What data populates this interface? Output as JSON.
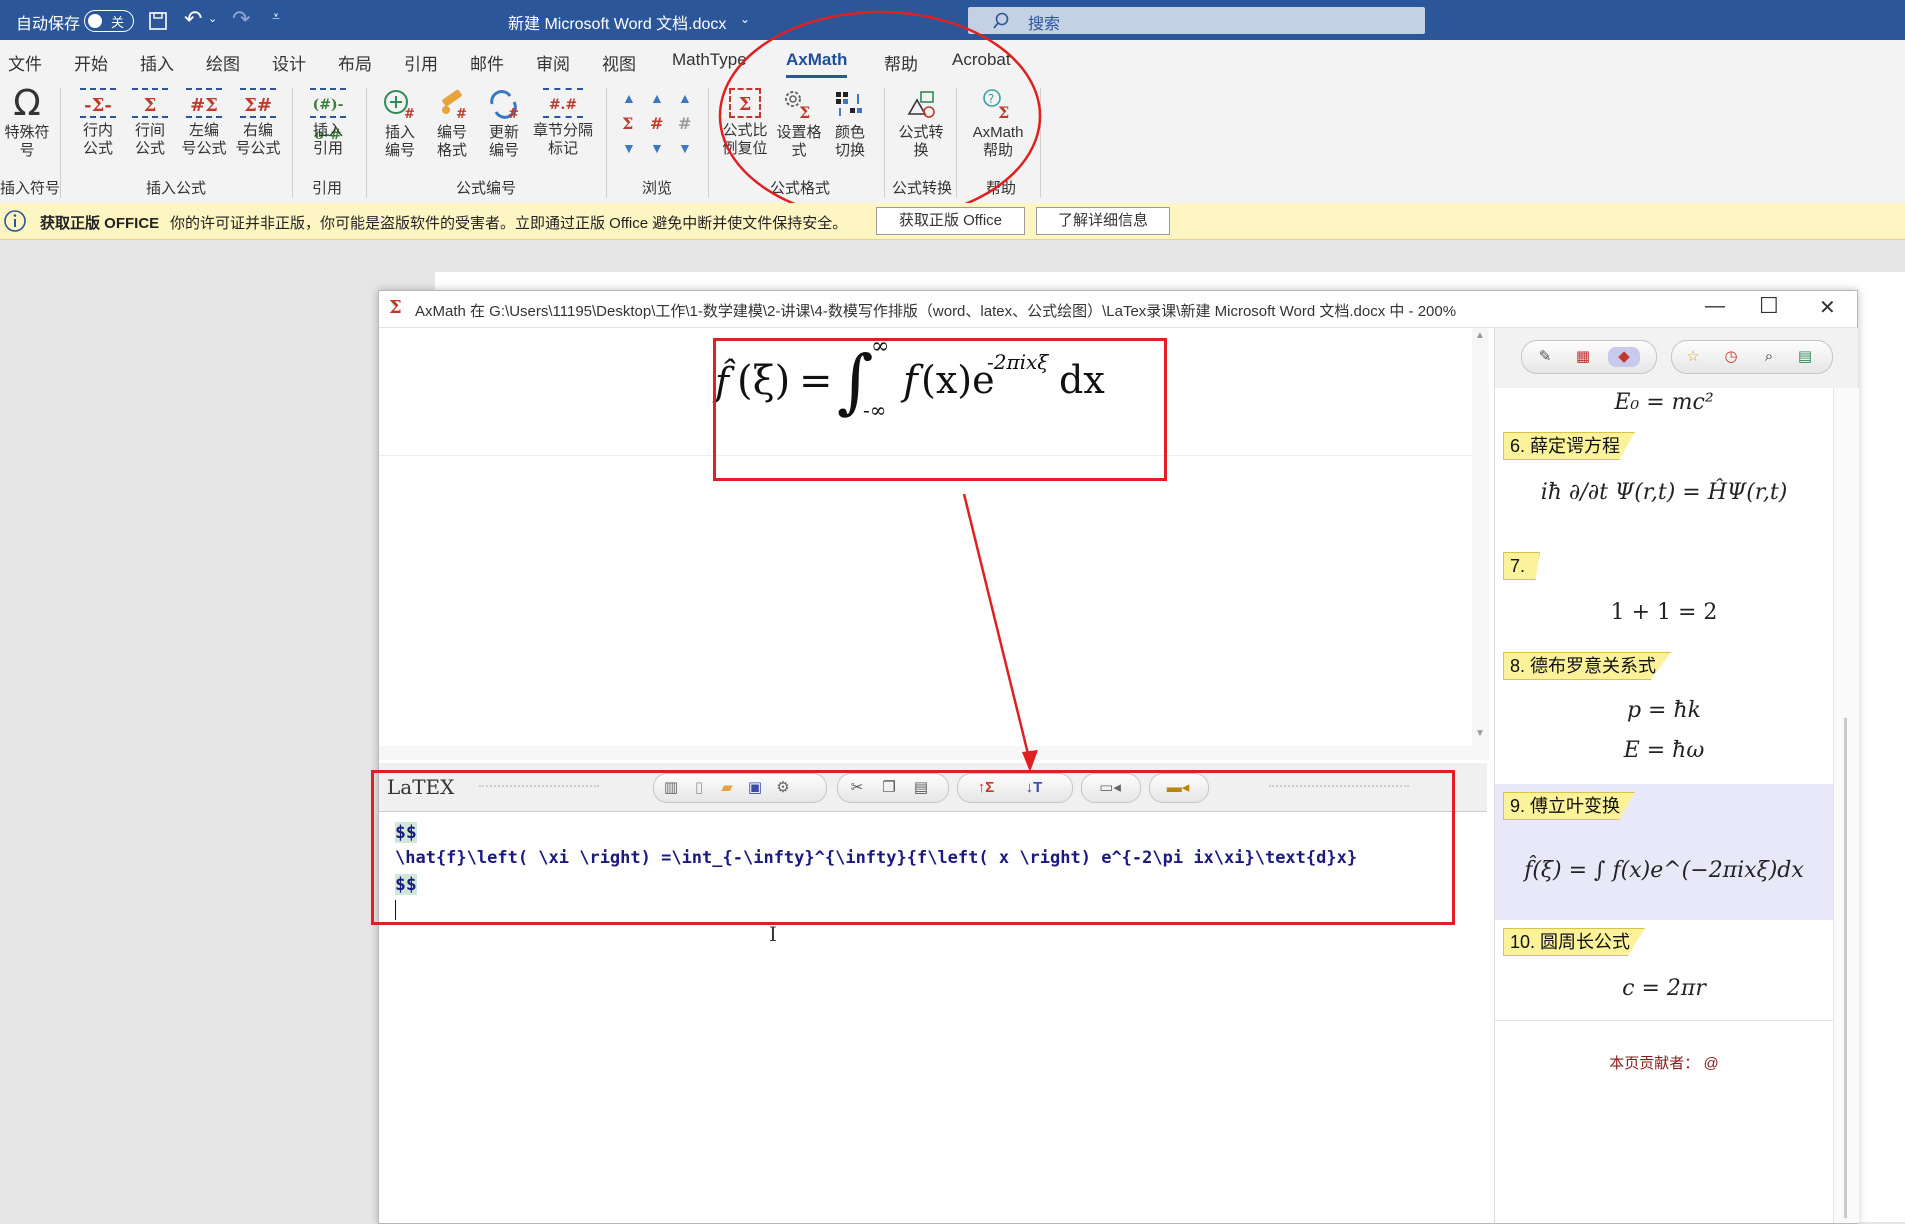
{
  "titlebar": {
    "autosave_label": "自动保存",
    "autosave_state": "关",
    "doc_title": "新建 Microsoft Word 文档.docx",
    "search_placeholder": "搜索"
  },
  "tabs": [
    "文件",
    "开始",
    "插入",
    "绘图",
    "设计",
    "布局",
    "引用",
    "邮件",
    "审阅",
    "视图",
    "MathType",
    "AxMath",
    "帮助",
    "Acrobat"
  ],
  "active_tab": "AxMath",
  "ribbon": {
    "special_symbol": "特殊符\n号",
    "inline_formula": "行内\n公式",
    "display_formula": "行间\n公式",
    "left_numbered": "左编\n号公式",
    "right_numbered": "右编\n号公式",
    "insert_ref": "插入\n引用",
    "insert_number": "插入\n编号",
    "number_format": "编号\n格式",
    "update_number": "更新\n编号",
    "chapter_mark": "章节分隔\n标记",
    "ratio_reset": "公式比\n例复位",
    "set_format": "设置格\n式",
    "color_switch": "颜色\n切换",
    "formula_convert": "公式转\n换",
    "axmath_help": "AxMath\n帮助",
    "groups": {
      "insert_symbol": "插入符号",
      "insert_formula": "插入公式",
      "reference": "引用",
      "formula_number": "公式编号",
      "browse": "浏览",
      "formula_format": "公式格式",
      "formula_convert": "公式转换",
      "help": "帮助"
    }
  },
  "notice": {
    "title": "获取正版 OFFICE",
    "message": "你的许可证并非正版，你可能是盗版软件的受害者。立即通过正版 Office 避免中断并使文件保持安全。",
    "btn_get": "获取正版 Office",
    "btn_more": "了解详细信息"
  },
  "axmath": {
    "title": "AxMath 在 G:\\Users\\11195\\Desktop\\工作\\1-数学建模\\2-讲课\\4-数模写作排版（word、latex、公式绘图）\\LaTex录课\\新建 Microsoft Word 文档.docx 中 - 200%",
    "latex_logo": "LaTEX",
    "code": {
      "line1": "$$",
      "line2": "\\hat{f}\\left( \\xi \\right) =\\int_{-\\infty}^{\\infty}{f\\left( x \\right) e^{-2\\pi ix\\xi}\\text{d}x}",
      "line3": "$$"
    }
  },
  "formula_library": {
    "top_formula": "E₀ = mc²",
    "items": [
      {
        "label": "6. 薛定谔方程",
        "formula": "iħ ∂/∂t Ψ(r,t) = ĤΨ(r,t)"
      },
      {
        "label": "7.",
        "formula": "1 + 1 = 2"
      },
      {
        "label": "8. 德布罗意关系式",
        "formula": "p = ħk",
        "formula2": "E = ħω"
      },
      {
        "label": "9. 傅立叶变换",
        "formula": "f̂(ξ) = ∫ f(x)e^(−2πixξ)dx"
      },
      {
        "label": "10. 圆周长公式",
        "formula": "c = 2πr"
      }
    ],
    "contributor": "本页贡献者： @"
  }
}
